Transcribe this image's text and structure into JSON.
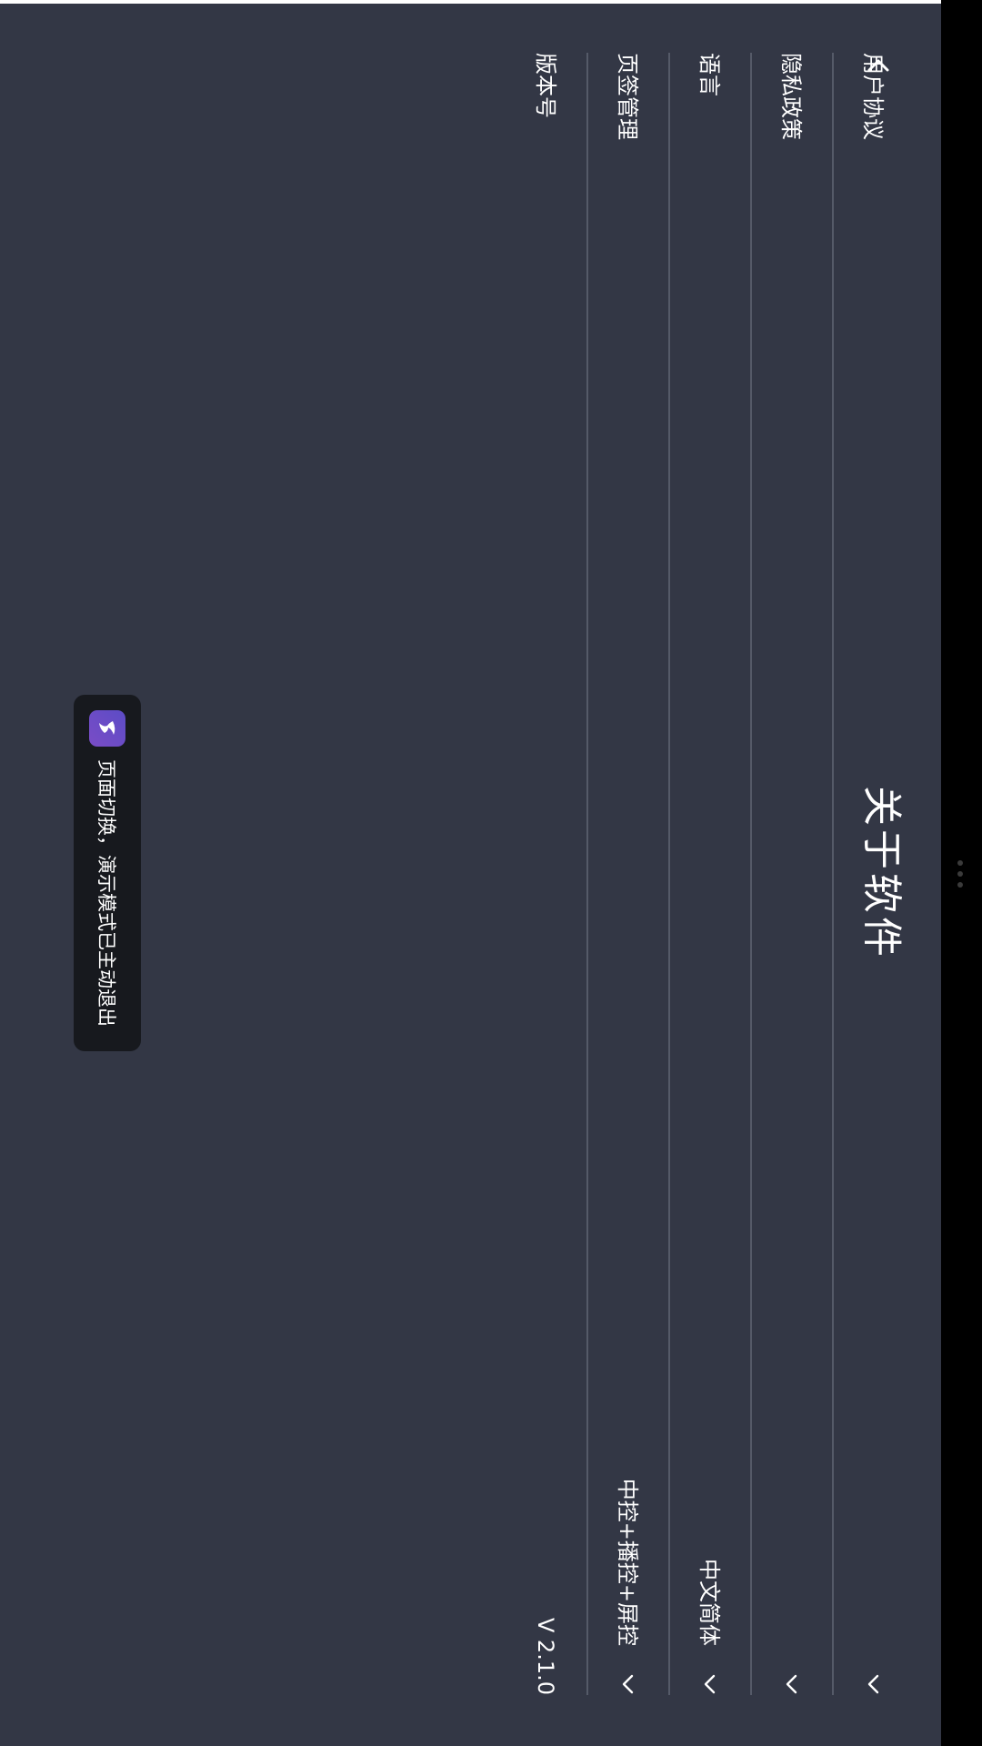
{
  "page": {
    "title": "关于软件",
    "back_icon": "chevron-left-icon"
  },
  "settings": [
    {
      "label": "用户协议",
      "value": "",
      "icon": "chevron-down-icon"
    },
    {
      "label": "隐私政策",
      "value": "",
      "icon": "chevron-down-icon"
    },
    {
      "label": "语言",
      "value": "中文简体",
      "icon": "chevron-down-icon"
    },
    {
      "label": "页签管理",
      "value": "中控+播控+屏控",
      "icon": "chevron-down-icon"
    },
    {
      "label": "版本号",
      "value": "V 2.1.0"
    }
  ],
  "toast": {
    "text": "页面切换，演示模式已主动退出",
    "icon": "app-logo-icon"
  },
  "colors": {
    "background": "#333745",
    "divider": "#555a68",
    "text": "#ffffff",
    "toast_bg": "#17191e",
    "app_icon": "#5c4cc6",
    "side_rail": "#000000"
  }
}
